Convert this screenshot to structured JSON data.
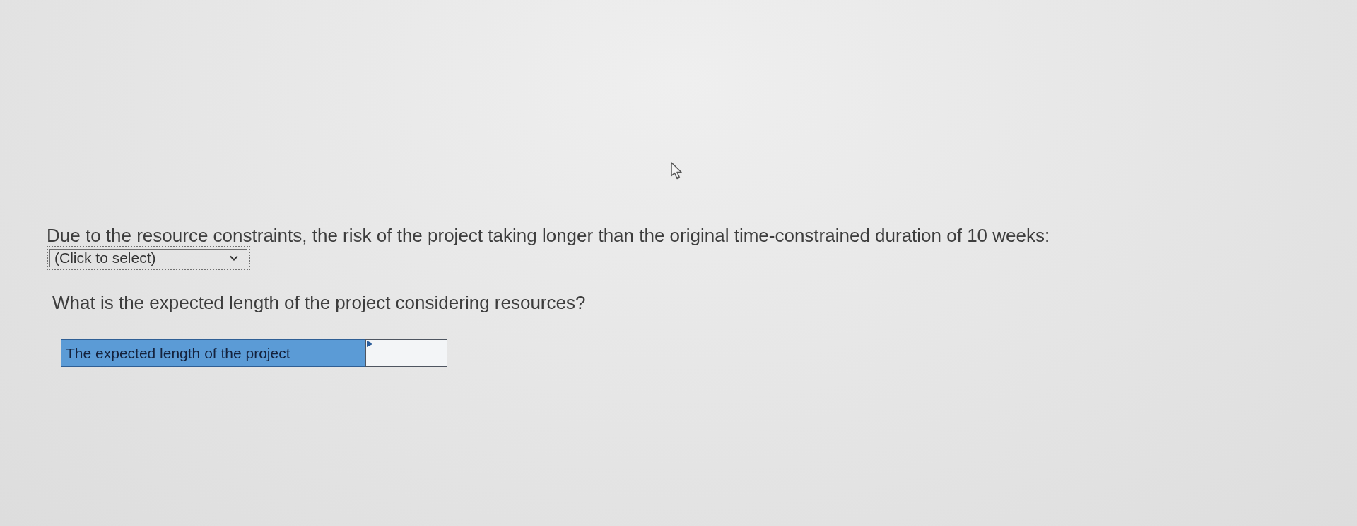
{
  "prompt": {
    "text": "Due to the resource constraints, the risk of the project taking longer than the original time-constrained duration of 10 weeks:"
  },
  "dropdown": {
    "value": "(Click to select)",
    "focused": true
  },
  "question": {
    "text": "What is the expected length of the project considering resources?"
  },
  "answer": {
    "label": "The expected length of the project"
  }
}
